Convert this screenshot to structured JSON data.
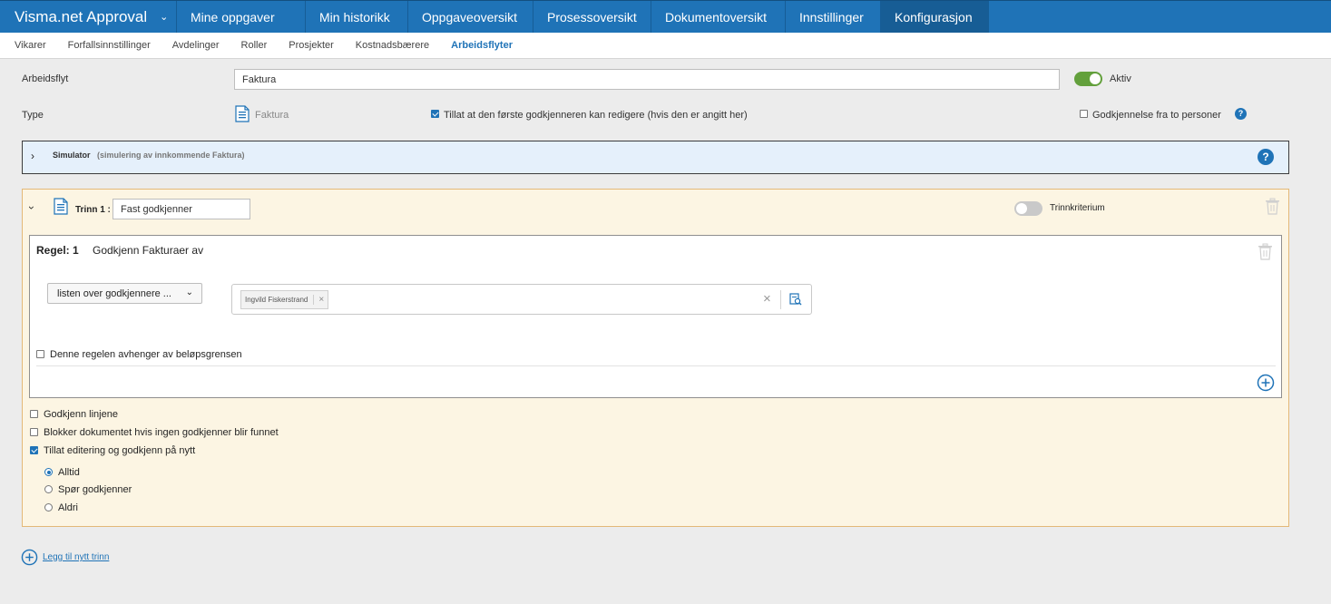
{
  "topnav": {
    "brand": "Visma.net Approval",
    "items": [
      "Mine oppgaver",
      "Min historikk",
      "Oppgaveoversikt",
      "Prosessoversikt",
      "Dokumentoversikt",
      "Innstillinger",
      "Konfigurasjon"
    ]
  },
  "subnav": {
    "items": [
      "Vikarer",
      "Forfallsinnstillinger",
      "Avdelinger",
      "Roller",
      "Prosjekter",
      "Kostnadsbærere",
      "Arbeidsflyter"
    ]
  },
  "form": {
    "workflow_label": "Arbeidsflyt",
    "workflow_value": "Faktura",
    "active_label": "Aktiv",
    "type_label": "Type",
    "type_value": "Faktura",
    "allow_first_edit_label": "Tillat at den første godkjenneren kan redigere (hvis den er angitt her)",
    "two_person_label": "Godkjennelse fra to personer"
  },
  "simulator": {
    "title": "Simulator",
    "subtitle": "(simulering av innkommende Faktura)"
  },
  "step": {
    "label": "Trinn 1 :",
    "name_value": "Fast godkjenner",
    "criterion_label": "Trinnkriterium",
    "rule": {
      "title": "Regel: 1",
      "description": "Godkjenn Fakturaer av",
      "dropdown_value": "listen over godkjennere ...",
      "approver_tag": "Ingvild Fiskerstrand",
      "amount_limit_label": "Denne regelen avhenger av beløpsgrensen"
    },
    "options": {
      "approve_lines": "Godkjenn linjene",
      "block_doc": "Blokker dokumentet hvis ingen godkjenner blir funnet",
      "allow_edit": "Tillat editering og godkjenn på nytt"
    },
    "radios": {
      "always": "Alltid",
      "ask": "Spør godkjenner",
      "never": "Aldri"
    }
  },
  "add_step_label": "Legg til nytt trinn",
  "colors": {
    "accent": "#1f73b7",
    "toggle_on": "#63a03c",
    "step_bg": "#fcf5e3",
    "simulator_bg": "#e5f0fb"
  }
}
